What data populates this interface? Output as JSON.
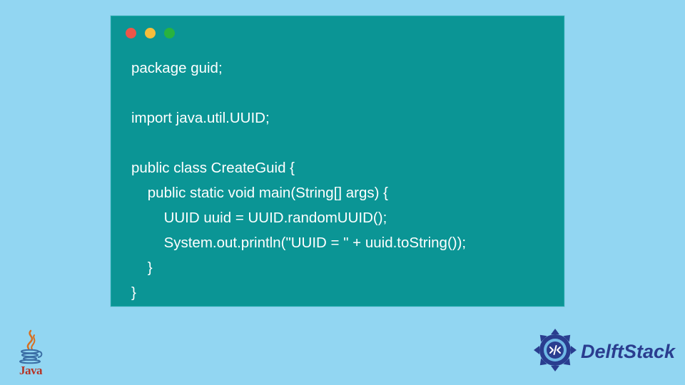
{
  "code": {
    "lines": [
      "package guid;",
      "",
      "import java.util.UUID;",
      "",
      "public class CreateGuid {",
      "    public static void main(String[] args) {",
      "        UUID uuid = UUID.randomUUID();",
      "        System.out.println(\"UUID = \" + uuid.toString());",
      "    }",
      "}"
    ]
  },
  "logos": {
    "java_label": "Java",
    "delftstack_label": "DelftStack"
  },
  "colors": {
    "background": "#92d6f2",
    "window": "#0b9595",
    "code_text": "#ffffff",
    "traffic_red": "#ec5549",
    "traffic_yellow": "#f6bd3b",
    "traffic_green": "#29b33f",
    "java_red": "#b63426",
    "delft_blue": "#2a3d8f"
  }
}
